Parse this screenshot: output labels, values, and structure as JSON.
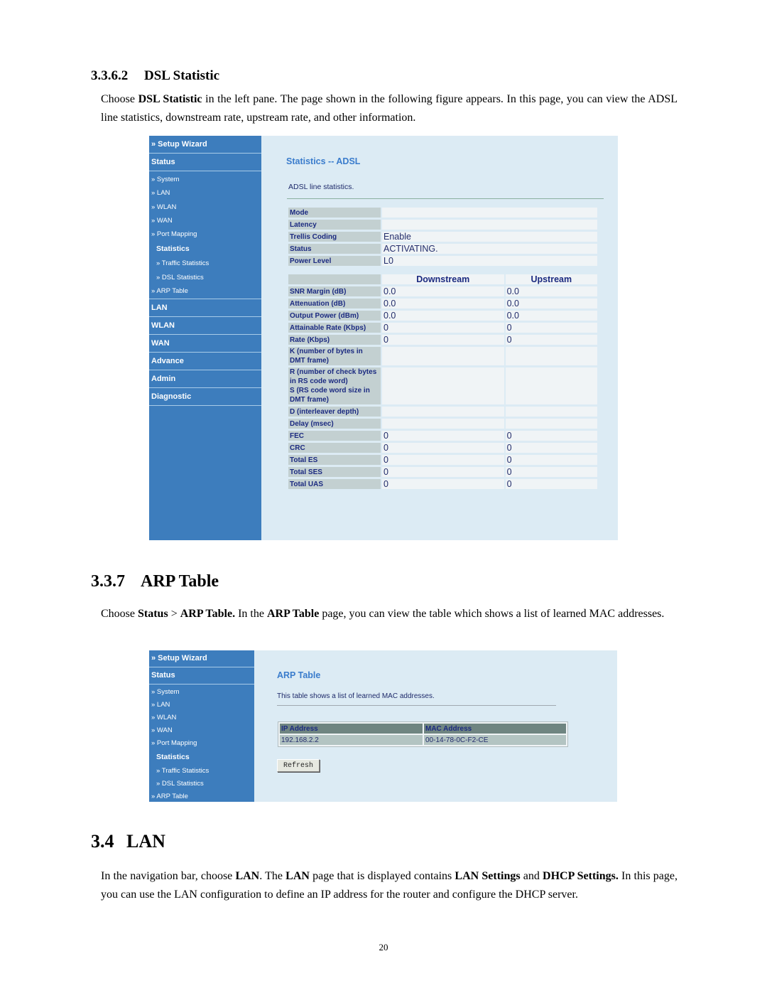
{
  "document": {
    "section_dsl": {
      "number": "3.3.6.2",
      "title": "DSL Statistic",
      "paragraph": [
        {
          "text": "Choose ",
          "bold": false
        },
        {
          "text": "DSL Statistic",
          "bold": true
        },
        {
          "text": " in the left pane. The page shown in the following figure appears. In this page, you can view the ADSL line statistics, downstream rate, upstream rate, and other information.",
          "bold": false
        }
      ]
    },
    "section_arp": {
      "number": "3.3.7",
      "title": "ARP Table",
      "paragraph": [
        {
          "text": "Choose ",
          "bold": false
        },
        {
          "text": "Status",
          "bold": true
        },
        {
          "text": " > ",
          "bold": false
        },
        {
          "text": "ARP Table.",
          "bold": true
        },
        {
          "text": " In the ",
          "bold": false
        },
        {
          "text": "ARP Table",
          "bold": true
        },
        {
          "text": " page, you can view the table which shows a list of learned MAC addresses.",
          "bold": false
        }
      ]
    },
    "section_lan": {
      "number": "3.4",
      "title": "LAN",
      "paragraph": [
        {
          "text": "In the navigation bar, choose ",
          "bold": false
        },
        {
          "text": "LAN",
          "bold": true
        },
        {
          "text": ". The ",
          "bold": false
        },
        {
          "text": "LAN",
          "bold": true
        },
        {
          "text": " page that is displayed contains ",
          "bold": false
        },
        {
          "text": "LAN Settings",
          "bold": true
        },
        {
          "text": " and ",
          "bold": false
        },
        {
          "text": "DHCP Settings.",
          "bold": true
        },
        {
          "text": " In this page, you can use the LAN configuration to define an IP address for the router and configure the DHCP server.",
          "bold": false
        }
      ]
    },
    "page_number": "20"
  },
  "nav": {
    "setup_wizard": "» Setup Wizard",
    "status": "Status",
    "status_items": [
      "» System",
      "» LAN",
      "» WLAN",
      "» WAN",
      "» Port Mapping"
    ],
    "statistics_group": "Statistics",
    "statistics_items": [
      "» Traffic Statistics",
      "» DSL Statistics"
    ],
    "arp_table": "» ARP Table",
    "main_items": [
      "LAN",
      "WLAN",
      "WAN",
      "Advance",
      "Admin",
      "Diagnostic"
    ]
  },
  "dsl_page": {
    "title": "Statistics -- ADSL",
    "description": "ADSL line statistics.",
    "general": [
      {
        "label": "Mode",
        "value": ""
      },
      {
        "label": "Latency",
        "value": ""
      },
      {
        "label": "Trellis Coding",
        "value": "Enable"
      },
      {
        "label": "Status",
        "value": "ACTIVATING."
      },
      {
        "label": "Power Level",
        "value": "L0"
      }
    ],
    "columns": [
      "Downstream",
      "Upstream"
    ],
    "rows": [
      {
        "label": "SNR Margin (dB)",
        "down": "0.0",
        "up": "0.0"
      },
      {
        "label": "Attenuation (dB)",
        "down": "0.0",
        "up": "0.0"
      },
      {
        "label": "Output Power (dBm)",
        "down": "0.0",
        "up": "0.0"
      },
      {
        "label": "Attainable Rate (Kbps)",
        "down": "0",
        "up": "0"
      },
      {
        "label": "Rate (Kbps)",
        "down": "0",
        "up": "0"
      },
      {
        "label": "K (number of bytes in DMT frame)",
        "down": "",
        "up": ""
      },
      {
        "label": "R (number of check bytes in RS code word)\nS (RS code word size in DMT frame)",
        "down": "",
        "up": ""
      },
      {
        "label": "D (interleaver depth)",
        "down": "",
        "up": ""
      },
      {
        "label": "Delay (msec)",
        "down": "",
        "up": ""
      },
      {
        "label": "FEC",
        "down": "0",
        "up": "0"
      },
      {
        "label": "CRC",
        "down": "0",
        "up": "0"
      },
      {
        "label": "Total ES",
        "down": "0",
        "up": "0"
      },
      {
        "label": "Total SES",
        "down": "0",
        "up": "0"
      },
      {
        "label": "Total UAS",
        "down": "0",
        "up": "0"
      }
    ]
  },
  "arp_page": {
    "title": "ARP Table",
    "description": "This table shows a list of learned MAC addresses.",
    "columns": [
      "IP Address",
      "MAC Address"
    ],
    "rows": [
      {
        "ip": "192.168.2.2",
        "mac": "00-14-78-0C-F2-CE"
      }
    ],
    "refresh_label": "Refresh"
  },
  "colors": {
    "nav_bg": "#3d7dbd",
    "content_bg": "#dcebf4",
    "title_blue": "#3a7ccc",
    "label_bg": "#c3d0d1",
    "value_bg": "#f0f4f6",
    "arp_header_bg": "#6f8581",
    "arp_row_bg": "#b3c4c2"
  }
}
